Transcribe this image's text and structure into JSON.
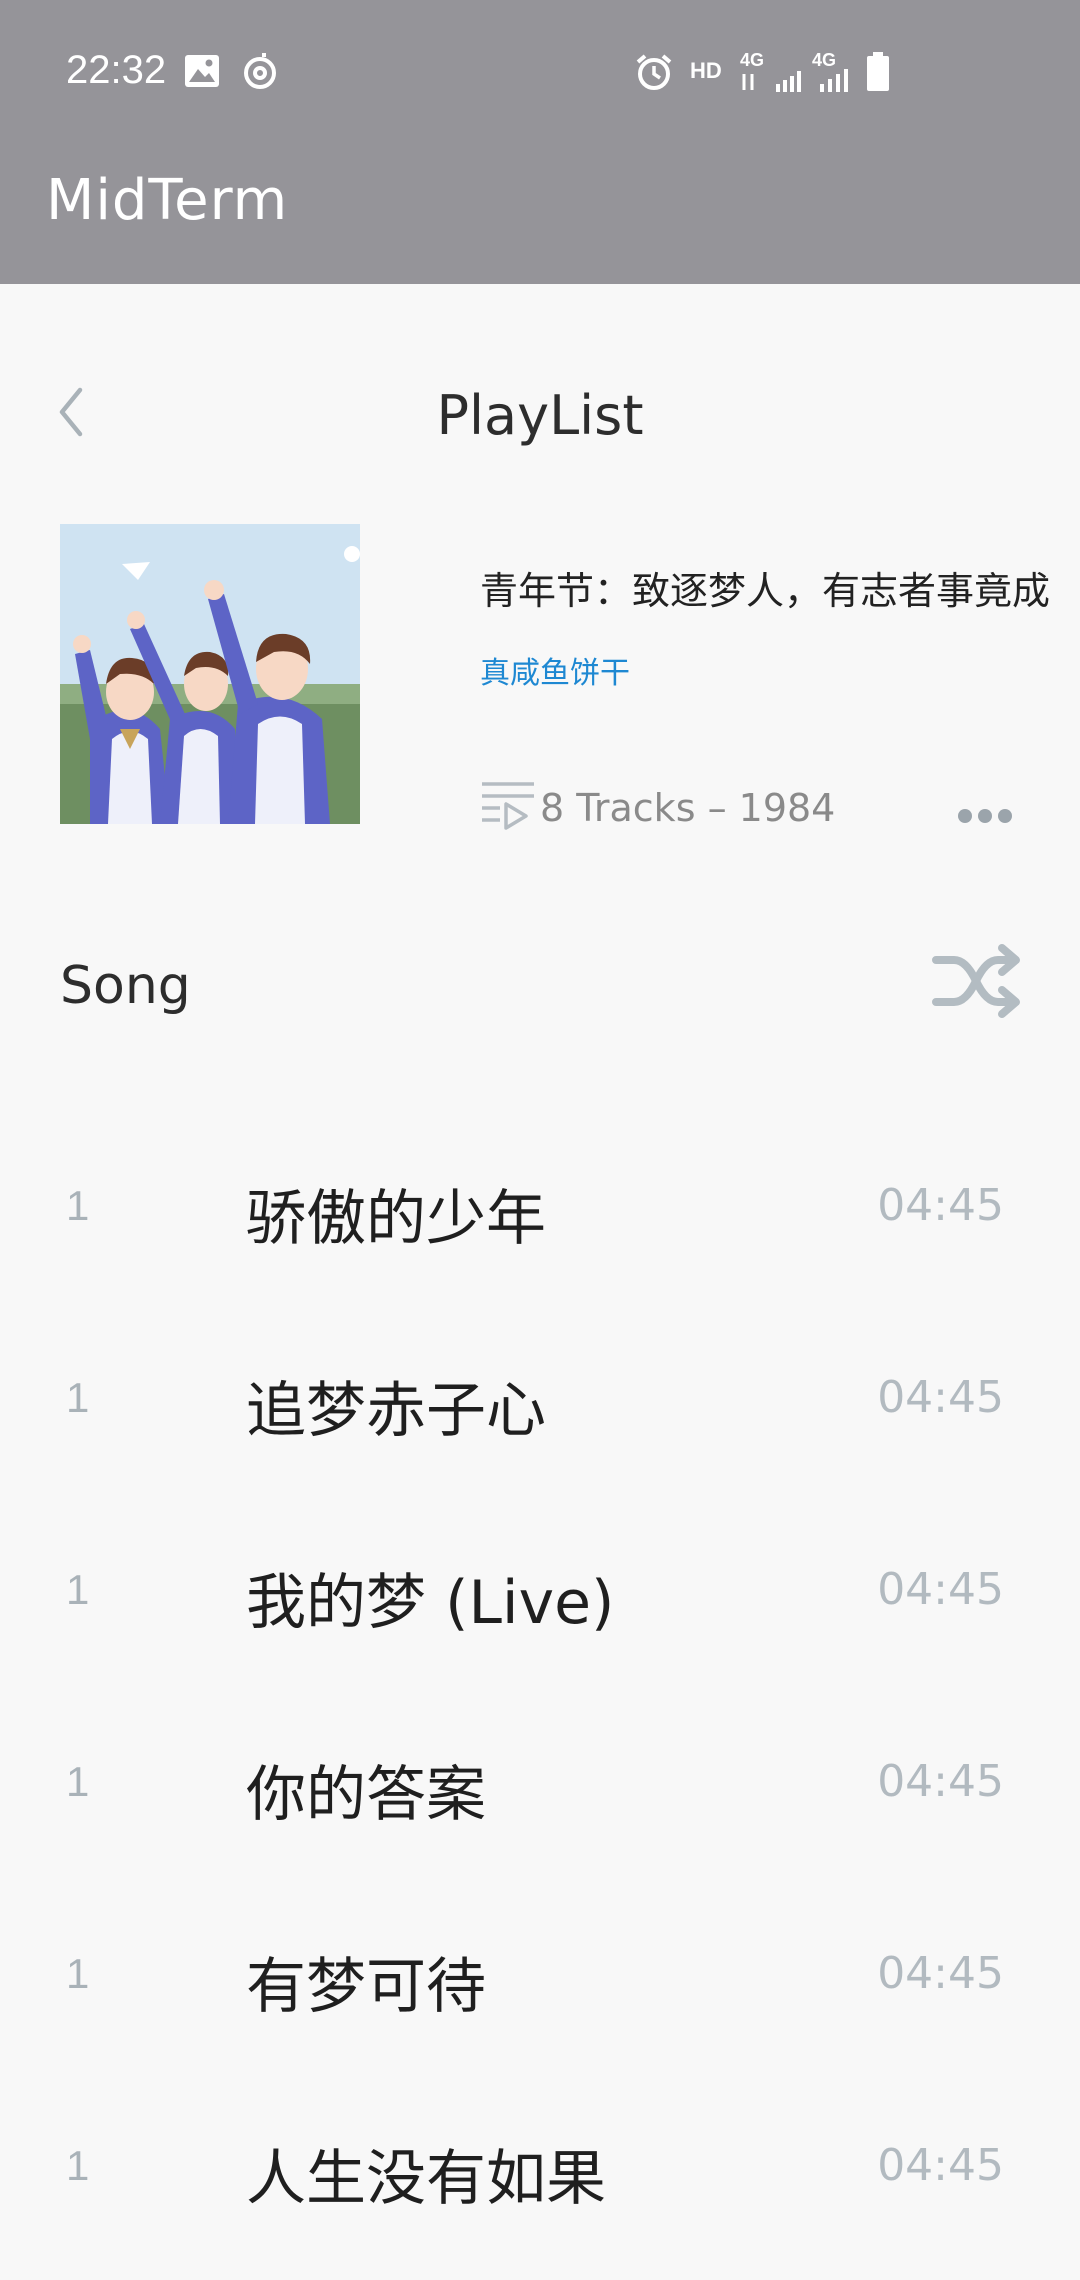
{
  "status_bar": {
    "time": "22:32",
    "hd": "HD",
    "network1": "4G",
    "network2": "4G",
    "icons": [
      "image-icon",
      "music-app-icon",
      "alarm-icon",
      "hd-icon",
      "signal-icon",
      "signal-icon",
      "battery-icon"
    ]
  },
  "app_bar": {
    "title": "MidTerm"
  },
  "header": {
    "title": "PlayList",
    "back_icon": "chevron-left-icon"
  },
  "playlist": {
    "name": "青年节：致逐梦人，有志者事竟成",
    "author": "真咸鱼饼干",
    "tracks_info": "8 Tracks – 1984",
    "tracks_icon": "playlist-icon",
    "more_icon": "more-horizontal-icon"
  },
  "section": {
    "title": "Song",
    "shuffle_icon": "shuffle-icon"
  },
  "songs": [
    {
      "index": "1",
      "title": "骄傲的少年",
      "duration": "04:45"
    },
    {
      "index": "1",
      "title": "追梦赤子心",
      "duration": "04:45"
    },
    {
      "index": "1",
      "title": "我的梦 (Live)",
      "duration": "04:45"
    },
    {
      "index": "1",
      "title": "你的答案",
      "duration": "04:45"
    },
    {
      "index": "1",
      "title": "有梦可待",
      "duration": "04:45"
    },
    {
      "index": "1",
      "title": "人生没有如果",
      "duration": "04:45"
    }
  ],
  "colors": {
    "topbar": "#959499",
    "background": "#f8f8f8",
    "author_link": "#1e88d2",
    "muted": "#b2bac0"
  }
}
